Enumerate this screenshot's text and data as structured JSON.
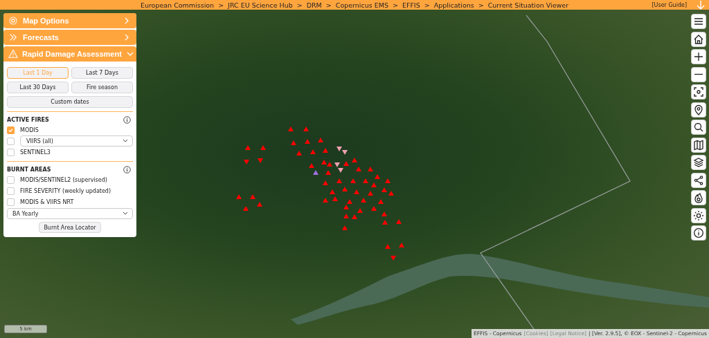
{
  "top_bar": {
    "breadcrumb": [
      "European Commission",
      "JRC EU Science Hub",
      "DRM",
      "Copernicus EMS",
      "EFFIS",
      "Applications",
      "Current Situation Viewer"
    ],
    "separator": ">",
    "user_guide": "[User Guide]"
  },
  "panel": {
    "sections": [
      {
        "title": "Map Options",
        "kind": "settings",
        "expanded": false
      },
      {
        "title": "Forecasts",
        "kind": "forecast",
        "expanded": false
      },
      {
        "title": "Rapid Damage Assessment",
        "kind": "assessment",
        "expanded": true
      }
    ],
    "periods": [
      {
        "label": "Last 1 Day",
        "selected": true
      },
      {
        "label": "Last 7 Days",
        "selected": false
      },
      {
        "label": "Last 30 Days",
        "selected": false
      },
      {
        "label": "Fire season",
        "selected": false
      },
      {
        "label": "Custom dates",
        "selected": false
      }
    ],
    "active_fires": {
      "title": "ACTIVE FIRES",
      "layers": [
        {
          "kind": "label",
          "label": "MODIS",
          "checked": true
        },
        {
          "kind": "select",
          "label": "VIIRS (all)",
          "checked": false
        },
        {
          "kind": "label",
          "label": "SENTINEL3",
          "checked": false
        }
      ]
    },
    "burnt_areas": {
      "title": "BURNT AREAS",
      "layers": [
        {
          "kind": "label",
          "label": "MODIS/SENTINEL2 (supervised)",
          "checked": false
        },
        {
          "kind": "label",
          "label": "FIRE SEVERITY (weekly updated)",
          "checked": false
        },
        {
          "kind": "label",
          "label": "MODIS & VIIRS NRT",
          "checked": false
        }
      ],
      "select": "BA Yearly",
      "button": "Burnt Area Locator"
    }
  },
  "scale_bar": "5 km",
  "attribution": {
    "prefix": "EFFIS - Copernicus",
    "links": [
      "[Cookies]",
      "[Legal Notice]"
    ],
    "suffix": "| [Ver. 2.9.5], © EOX - Sentinel-2 - Copernicus"
  }
}
